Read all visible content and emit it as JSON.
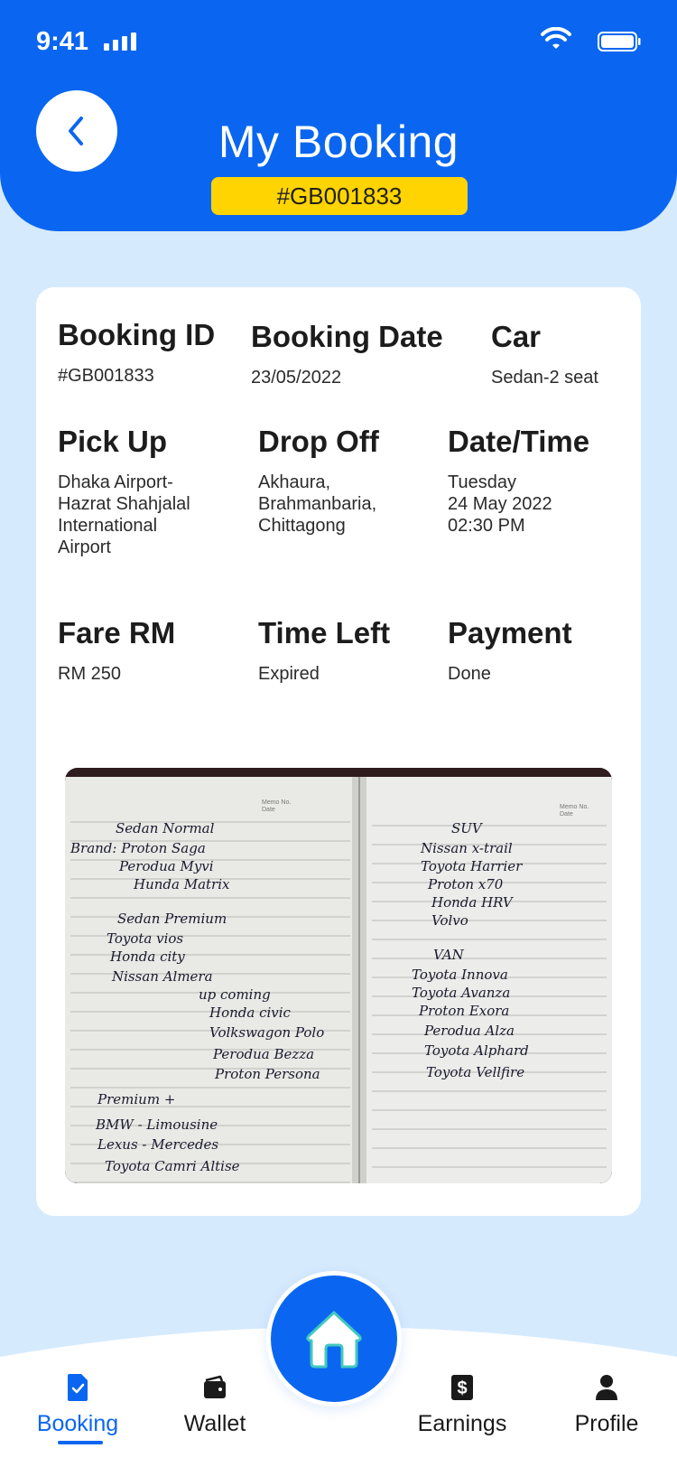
{
  "status_bar": {
    "time": "9:41"
  },
  "header": {
    "title": "My Booking",
    "booking_badge": "#GB001833"
  },
  "details": {
    "booking_id": {
      "label": "Booking ID",
      "value": "#GB001833"
    },
    "booking_date": {
      "label": "Booking Date",
      "value": "23/05/2022"
    },
    "car": {
      "label": "Car",
      "value": "Sedan-2 seat"
    },
    "pick_up": {
      "label": "Pick Up",
      "value": "Dhaka Airport-\nHazrat Shahjalal\nInternational\nAirport"
    },
    "drop_off": {
      "label": "Drop Off",
      "value": "Akhaura,\nBrahmanbaria,\nChittagong"
    },
    "date_time": {
      "label": "Date/Time",
      "value": "Tuesday\n24 May 2022\n02:30 PM"
    },
    "fare": {
      "label": "Fare RM",
      "value": "RM 250"
    },
    "time_left": {
      "label": "Time Left",
      "value": "Expired"
    },
    "payment": {
      "label": "Payment",
      "value": "Done"
    }
  },
  "photo": {
    "left_page": [
      "Sedan Normal",
      "Brand: Proton Saga",
      "Perodua Myvi",
      "Hunda Matrix",
      "Sedan Premium",
      "Toyota vios",
      "Honda city",
      "Nissan Almera",
      "up coming",
      "Honda civic",
      "Volkswagon Polo",
      "Perodua Bezza",
      "Proton Persona",
      "Premium +",
      "BMW - Limousine",
      "Lexus - Mercedes",
      "Toyota Camri Altise"
    ],
    "right_page": [
      "SUV",
      "Nissan x-trail",
      "Toyota Harrier",
      "Proton x70",
      "Honda HRV",
      "Volvo",
      "VAN",
      "Toyota Innova",
      "Toyota Avanza",
      "Proton Exora",
      "Perodua Alza",
      "Toyota Alphard",
      "Toyota Vellfire"
    ],
    "memo_label": "Memo No.",
    "date_label": "Date"
  },
  "bottom_nav": {
    "items": [
      {
        "label": "Booking",
        "icon": "booking-icon",
        "active": true
      },
      {
        "label": "Wallet",
        "icon": "wallet-icon",
        "active": false
      },
      {
        "label": "Earnings",
        "icon": "dollar-icon",
        "active": false
      },
      {
        "label": "Profile",
        "icon": "user-icon",
        "active": false
      }
    ],
    "home_icon": "home-icon"
  },
  "colors": {
    "primary": "#0a66f0",
    "badge": "#ffd400",
    "background": "#d6eafd"
  }
}
